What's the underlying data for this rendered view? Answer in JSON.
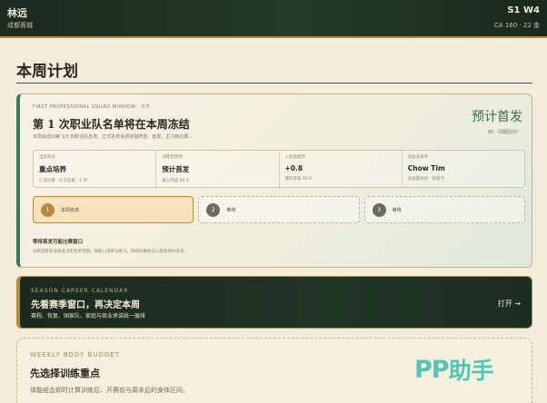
{
  "header": {
    "player_name": "林远",
    "club": "成都蓉城",
    "season_week": "S1 W4",
    "ca_money": "CA 160 · 22 金"
  },
  "page_title": "本周计划",
  "squad_card": {
    "eyebrow": "FIRST PROFESSIONAL SQUAD WINDOW · 0/5",
    "title": "第 1 次职业队名单将在本周冻结",
    "description": "本周会选出第 1/3 份职业队名单。正式名单会把完整阵容、首发、主力和比赛…",
    "prediction": "预计首发",
    "prediction_note": "90 · 间隔回归！",
    "stats": [
      {
        "label": "当前状态",
        "value": "重点培养",
        "note": "2 次比赛 · 0 次首发 · 1 评"
      },
      {
        "label": "训练营预测",
        "value": "预计首发",
        "note": "进入阵容 88.6"
      },
      {
        "label": "入队后趋势",
        "value": "+0.8",
        "note": "潜在阵容 90.0"
      },
      {
        "label": "同位竞争手",
        "value": "Chow Tim",
        "note": "同位置对比 · 阵容卡"
      }
    ],
    "steps": [
      {
        "num": "1",
        "label": "本周名单"
      },
      {
        "num": "2",
        "label": "等待"
      },
      {
        "num": "3",
        "label": "等待"
      }
    ],
    "footer_title": "等待首发可能比赛窗口",
    "footer_desc": "训练后阵容表现会决定名单范围，请耐心培养与练习，保持比赛状态以获得更好名单。"
  },
  "calendar_banner": {
    "eyebrow": "SEASON CAREER CALENDAR",
    "title": "先看赛季窗口，再决定本周",
    "description": "赛程、恢复、国家队、家庭与商业承诺统一展排",
    "open_label": "打开 →"
  },
  "body_budget": {
    "eyebrow": "WEEKLY BODY BUDGET",
    "title": "先选择训练重点",
    "description": "体能组会即时计算训练后、开赛前与周末后的身体区间。"
  },
  "watermark": {
    "latin": "PP",
    "cn": "助手"
  },
  "colors": {
    "accent_green": "#3f7a55",
    "gold": "#b38a3e",
    "dark_green": "#1c2a1f",
    "watermark": "#54c4b4"
  }
}
